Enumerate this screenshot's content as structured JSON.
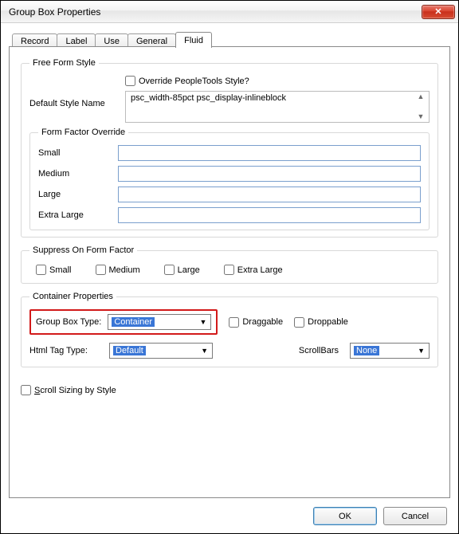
{
  "window": {
    "title": "Group Box Properties"
  },
  "tabs": [
    "Record",
    "Label",
    "Use",
    "General",
    "Fluid"
  ],
  "activeTab": 4,
  "freeFormStyle": {
    "legend": "Free Form Style",
    "overrideLabel": "Override PeopleTools Style?",
    "overrideChecked": false,
    "defaultStyleLabel": "Default Style Name",
    "defaultStyleValue": "psc_width-85pct psc_display-inlineblock"
  },
  "formFactorOverride": {
    "legend": "Form Factor Override",
    "fields": [
      {
        "label": "Small",
        "value": ""
      },
      {
        "label": "Medium",
        "value": ""
      },
      {
        "label": "Large",
        "value": ""
      },
      {
        "label": "Extra Large",
        "value": ""
      }
    ]
  },
  "suppress": {
    "legend": "Suppress On Form Factor",
    "items": [
      {
        "label": "Small",
        "checked": false
      },
      {
        "label": "Medium",
        "checked": false
      },
      {
        "label": "Large",
        "checked": false
      },
      {
        "label": "Extra Large",
        "checked": false
      }
    ]
  },
  "container": {
    "legend": "Container Properties",
    "groupBoxTypeLabel": "Group Box Type:",
    "groupBoxTypeValue": "Container",
    "draggableLabel": "Draggable",
    "draggableChecked": false,
    "droppableLabel": "Droppable",
    "droppableChecked": false,
    "htmlTagLabel": "Html Tag Type:",
    "htmlTagValue": "Default",
    "scrollBarsLabel": "ScrollBars",
    "scrollBarsValue": "None"
  },
  "scrollSizing": {
    "label": "Scroll Sizing by Style",
    "checked": false
  },
  "buttons": {
    "ok": "OK",
    "cancel": "Cancel"
  }
}
